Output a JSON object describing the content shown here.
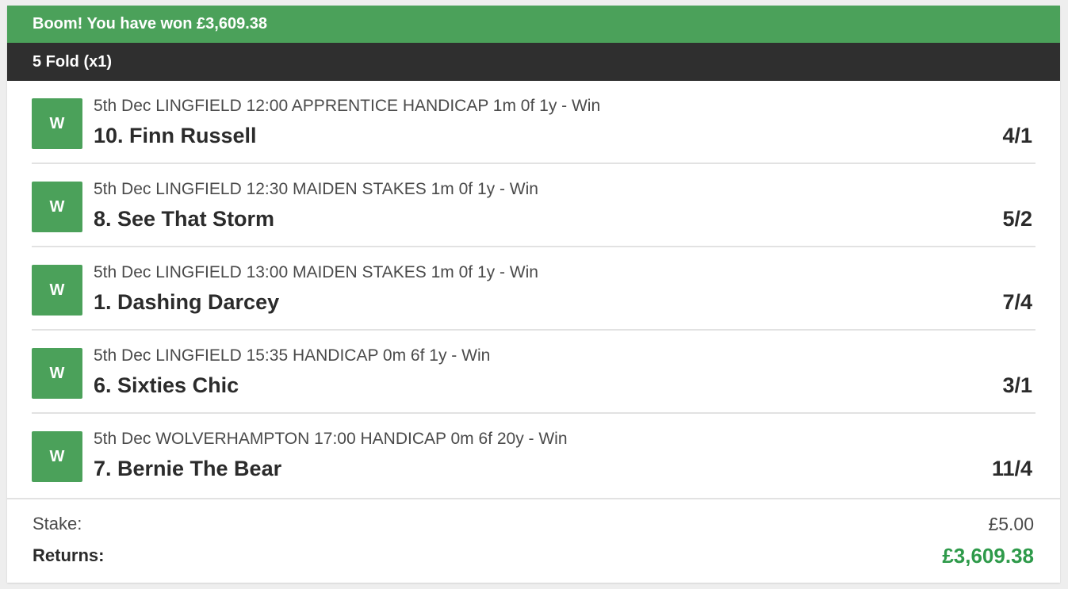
{
  "banner": {
    "text": "Boom! You have won £3,609.38"
  },
  "bet": {
    "type": "5 Fold (x1)"
  },
  "selections": [
    {
      "result": "W",
      "event": "5th Dec LINGFIELD 12:00 APPRENTICE HANDICAP 1m 0f 1y - Win",
      "runner": "10. Finn Russell",
      "odds": "4/1"
    },
    {
      "result": "W",
      "event": "5th Dec LINGFIELD 12:30 MAIDEN STAKES 1m 0f 1y - Win",
      "runner": "8. See That Storm",
      "odds": "5/2"
    },
    {
      "result": "W",
      "event": "5th Dec LINGFIELD 13:00 MAIDEN STAKES 1m 0f 1y - Win",
      "runner": "1. Dashing Darcey",
      "odds": "7/4"
    },
    {
      "result": "W",
      "event": "5th Dec LINGFIELD 15:35 HANDICAP 0m 6f 1y - Win",
      "runner": "6. Sixties Chic",
      "odds": "3/1"
    },
    {
      "result": "W",
      "event": "5th Dec WOLVERHAMPTON 17:00 HANDICAP 0m 6f 20y - Win",
      "runner": "7. Bernie The Bear",
      "odds": "11/4"
    }
  ],
  "summary": {
    "stake_label": "Stake:",
    "stake_value": "£5.00",
    "returns_label": "Returns:",
    "returns_value": "£3,609.38"
  },
  "colors": {
    "win_green": "#4ba15a",
    "header_dark": "#2f2f2f",
    "returns_green": "#2e9a4a"
  }
}
